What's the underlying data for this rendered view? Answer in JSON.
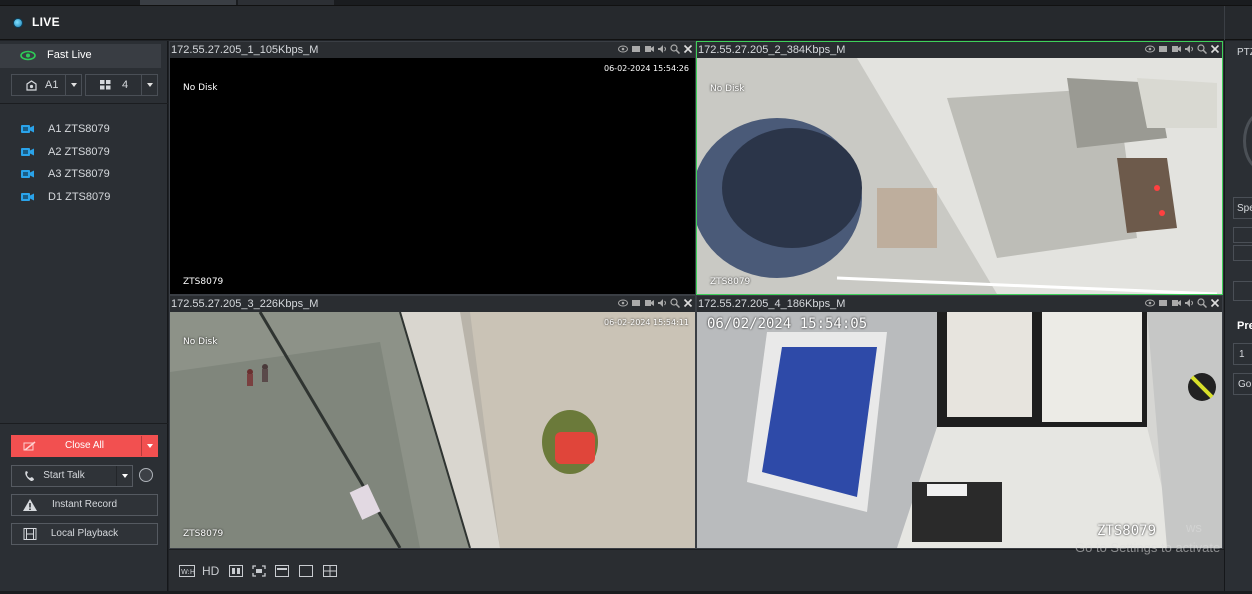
{
  "header": {
    "title": "LIVE"
  },
  "sidebar": {
    "fast_live_label": "Fast Live",
    "view_select": "A1",
    "layout_select": "4",
    "devices": [
      "A1 ZTS8079",
      "A2 ZTS8079",
      "A3 ZTS8079",
      "D1 ZTS8079"
    ],
    "buttons": {
      "close_all": "Close All",
      "start_talk": "Start Talk",
      "instant_record": "Instant Record",
      "local_playback": "Local Playback"
    }
  },
  "cells": [
    {
      "title": "172.55.27.205_1_105Kbps_M",
      "no_disk": "No Disk",
      "timestamp": "06-02-2024 15:54:26",
      "camera": "ZTS8079"
    },
    {
      "title": "172.55.27.205_2_384Kbps_M",
      "no_disk": "No Disk",
      "timestamp": "",
      "camera": "ZTS8079"
    },
    {
      "title": "172.55.27.205_3_226Kbps_M",
      "no_disk": "No Disk",
      "timestamp": "06-02-2024 15:54:11",
      "camera": "ZTS8079"
    },
    {
      "title": "172.55.27.205_4_186Kbps_M",
      "no_disk": "",
      "timestamp": "06/02/2024 15:54:05",
      "camera": "ZTS8079"
    }
  ],
  "toolbar": {
    "hd_label": "HD"
  },
  "watermark": {
    "line1": "ws",
    "line2": "Go to Settings to activate W"
  },
  "ptz": {
    "title": "PTZ",
    "speed": "Spe",
    "preset": "Pre",
    "preset_value": "1",
    "go_button": "Go"
  },
  "colors": {
    "accent_red": "#f25050",
    "active_border": "#3fd05a",
    "camera_icon": "#2aa3ea"
  }
}
